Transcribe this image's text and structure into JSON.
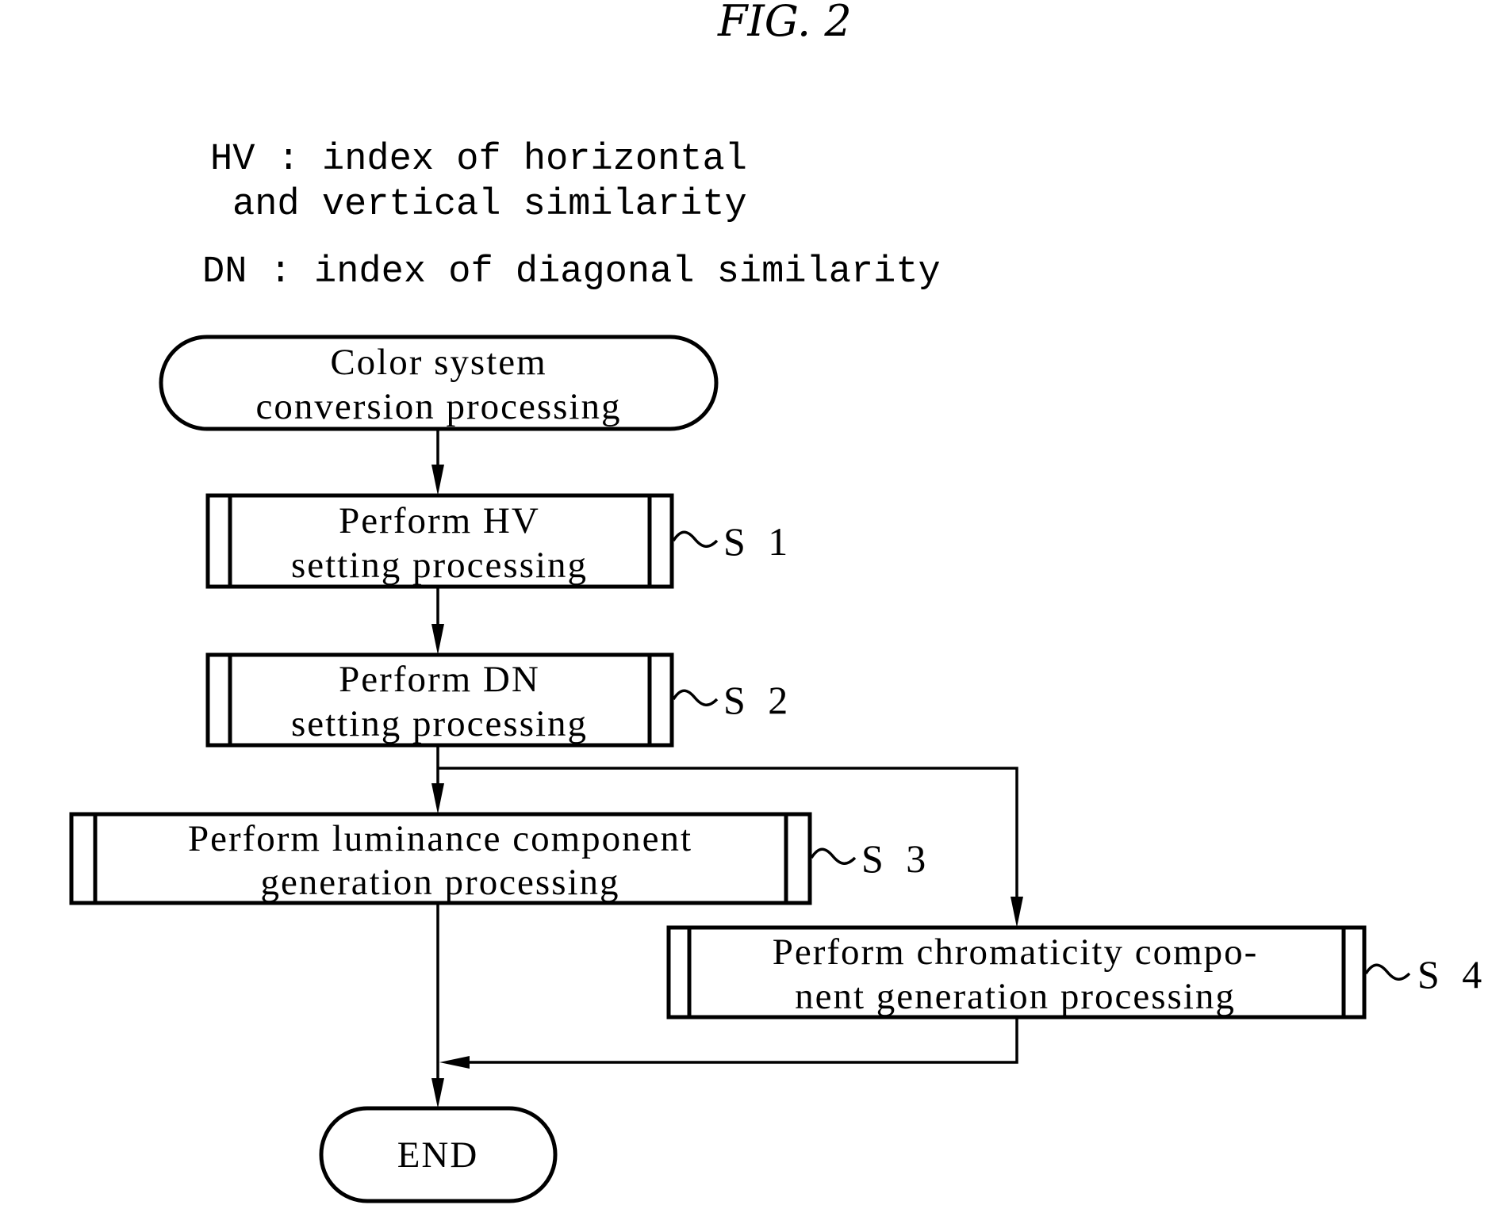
{
  "figure": {
    "title": "FIG. 2"
  },
  "legend": {
    "hv_line1": "HV : index of horizontal",
    "hv_line2": "and vertical similarity",
    "dn_line1": "DN : index of diagonal similarity"
  },
  "flowchart": {
    "start": {
      "line1": "Color system",
      "line2": "conversion processing"
    },
    "steps": [
      {
        "id": "S 1",
        "line1": "Perform HV",
        "line2": "setting processing"
      },
      {
        "id": "S 2",
        "line1": "Perform DN",
        "line2": "setting processing"
      },
      {
        "id": "S 3",
        "line1": "Perform luminance component",
        "line2": "generation processing"
      },
      {
        "id": "S 4",
        "line1": "Perform chromaticity compo-",
        "line2": "nent generation processing"
      }
    ],
    "end": {
      "label": "END"
    },
    "edges": [
      {
        "from": "start",
        "to": "S 1"
      },
      {
        "from": "S 1",
        "to": "S 2"
      },
      {
        "from": "S 2",
        "to": "S 3"
      },
      {
        "from": "S 2",
        "to": "S 4"
      },
      {
        "from": "S 3",
        "to": "end"
      },
      {
        "from": "S 4",
        "to": "end"
      }
    ]
  }
}
